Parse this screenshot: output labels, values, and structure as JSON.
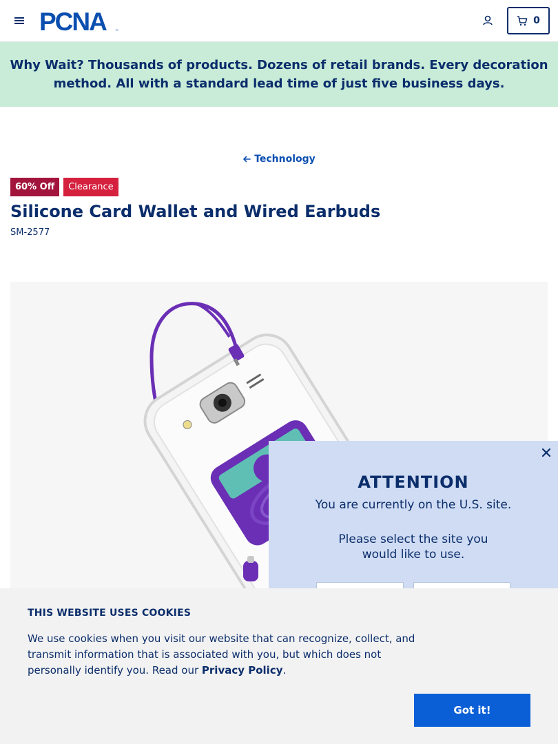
{
  "header": {
    "logo_text": "PCNA",
    "cart_count": "0"
  },
  "banner": {
    "lead": "Why Wait?",
    "text": " Thousands of products. Dozens of retail brands. Every decoration method. All with a standard lead time of just five business days."
  },
  "breadcrumb": {
    "label": "Technology"
  },
  "product": {
    "badges": [
      "60% Off",
      "Clearance"
    ],
    "title": "Silicone Card Wallet and Wired Earbuds",
    "sku": "SM-2577"
  },
  "attention": {
    "title": "ATTENTION",
    "line1": "You are currently on the U.S. site.",
    "line2": "Please select the site you would like to use."
  },
  "cookie": {
    "title": "THIS WEBSITE USES COOKIES",
    "text": "We use cookies when you visit our website that can recognize, collect, and transmit information that is associated with you, but which does not personally identify you. Read our ",
    "link": "Privacy Policy",
    "text_end": ".",
    "button": "Got it!"
  },
  "colors": {
    "brand_navy": "#0b2d6b",
    "banner_bg": "#c8ecd8",
    "discount_badge": "#a3143c",
    "clearance_badge": "#d5203e",
    "product_purple": "#6a2fb5",
    "cta_blue": "#0b5fd6"
  },
  "icons": {
    "menu": "hamburger-icon",
    "account": "user-icon",
    "cart": "cart-icon",
    "back": "arrow-left-icon",
    "close": "close-icon"
  }
}
